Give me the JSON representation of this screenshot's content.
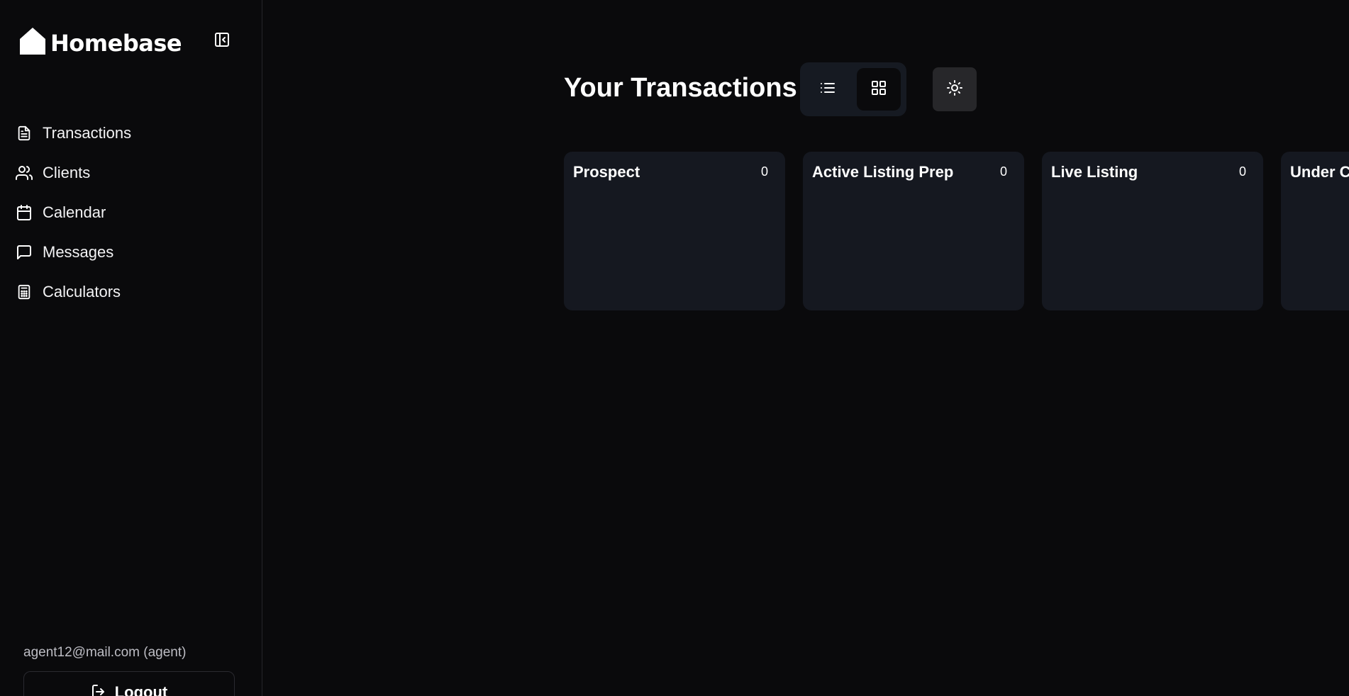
{
  "app": {
    "name": "Homebase"
  },
  "sidebar": {
    "items": [
      {
        "label": "Transactions",
        "icon": "document-icon"
      },
      {
        "label": "Clients",
        "icon": "users-icon"
      },
      {
        "label": "Calendar",
        "icon": "calendar-icon"
      },
      {
        "label": "Messages",
        "icon": "message-square-icon"
      },
      {
        "label": "Calculators",
        "icon": "calculator-icon"
      }
    ],
    "user": "agent12@mail.com (agent)",
    "logout_label": "Logout"
  },
  "main": {
    "title": "Your Transactions",
    "view_toggle": {
      "options": [
        "list",
        "grid"
      ],
      "selected": "grid"
    },
    "columns": [
      {
        "title": "Prospect",
        "count": "0"
      },
      {
        "title": "Active Listing Prep",
        "count": "0"
      },
      {
        "title": "Live Listing",
        "count": "0"
      },
      {
        "title": "Under Co",
        "count": ""
      }
    ]
  },
  "colors": {
    "background": "#0a0a0c",
    "card": "#151820",
    "toggle_bg": "#161a22",
    "theme_button": "#27272a",
    "text": "#ffffff"
  }
}
